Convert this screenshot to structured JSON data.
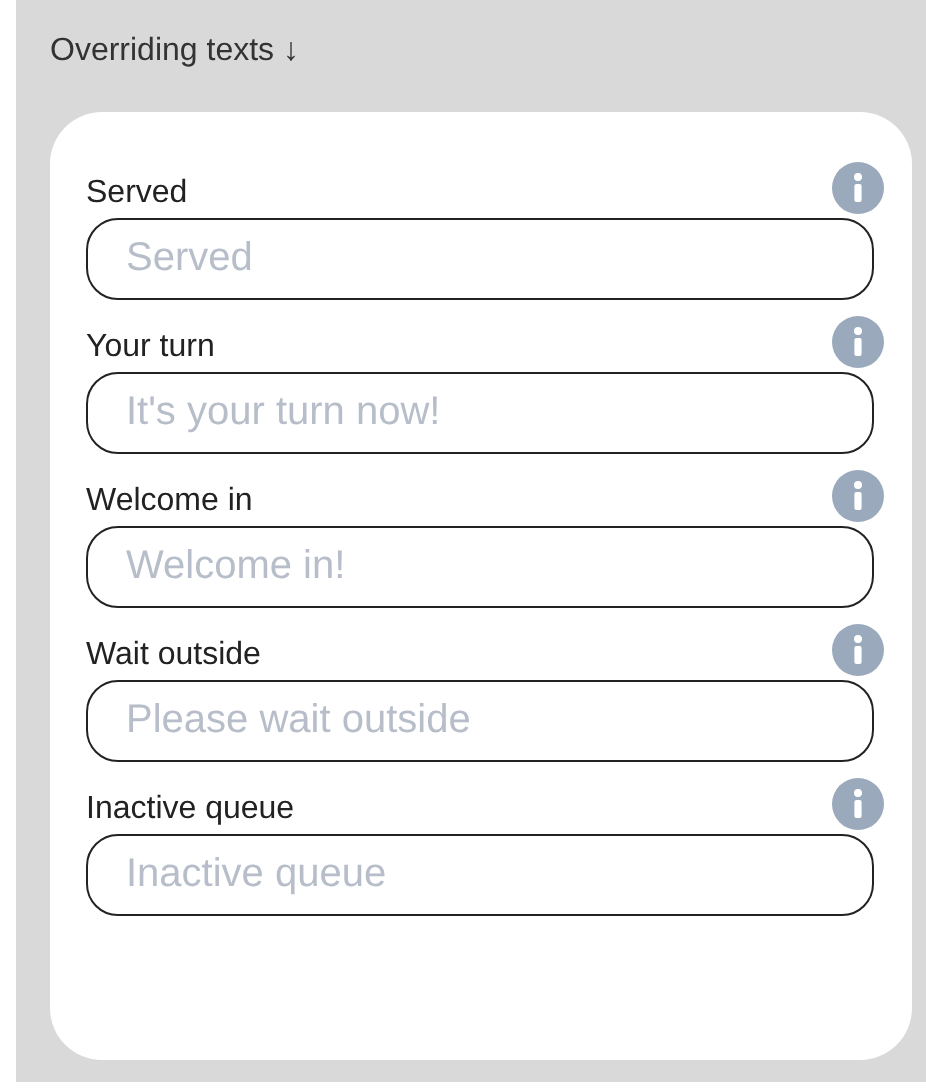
{
  "section": {
    "title": "Overriding texts ↓"
  },
  "fields": [
    {
      "label": "Served",
      "placeholder": "Served"
    },
    {
      "label": "Your turn",
      "placeholder": "It's your turn now!"
    },
    {
      "label": "Welcome in",
      "placeholder": "Welcome in!"
    },
    {
      "label": "Wait outside",
      "placeholder": "Please wait outside"
    },
    {
      "label": "Inactive queue",
      "placeholder": "Inactive queue"
    }
  ]
}
